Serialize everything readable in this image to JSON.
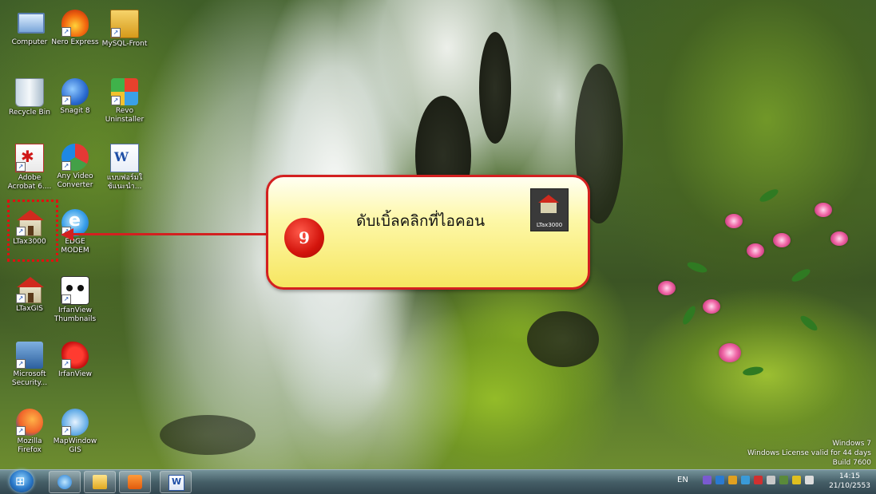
{
  "desktop_icons": [
    {
      "label": "Computer",
      "icon": "computer-icon"
    },
    {
      "label": "Nero Express",
      "icon": "nero-icon"
    },
    {
      "label": "MySQL-Front",
      "icon": "mysql-front-icon"
    },
    {
      "label": "Recycle Bin",
      "icon": "recycle-bin-icon"
    },
    {
      "label": "Snagit 8",
      "icon": "snagit-icon"
    },
    {
      "label": "Revo\nUninstaller",
      "icon": "revo-uninstaller-icon"
    },
    {
      "label": "Adobe\nAcrobat 6....",
      "icon": "acrobat-icon"
    },
    {
      "label": "Any Video\nConverter",
      "icon": "video-converter-icon"
    },
    {
      "label": "แบบฟอร์มใ\nช้แนะนำ...",
      "icon": "word-document-icon"
    },
    {
      "label": "LTax3000",
      "icon": "ltax3000-icon"
    },
    {
      "label": "EDGE\nMODEM",
      "icon": "edge-modem-icon"
    },
    {
      "label": "LTaxGIS",
      "icon": "ltaxgis-icon"
    },
    {
      "label": "IrfanView\nThumbnails",
      "icon": "irfanview-thumbnails-icon"
    },
    {
      "label": "Microsoft\nSecurity...",
      "icon": "microsoft-security-icon"
    },
    {
      "label": "IrfanView",
      "icon": "irfanview-icon"
    },
    {
      "label": "Mozilla\nFirefox",
      "icon": "firefox-icon"
    },
    {
      "label": "MapWindow\nGIS",
      "icon": "mapwindow-icon"
    }
  ],
  "callout": {
    "step_number": "9",
    "instruction": "ดับเบิ้ลคลิกที่ไอคอน",
    "icon_caption": "LTax3000"
  },
  "watermark": {
    "line1": "Windows 7",
    "line2": "Windows License valid for 44 days",
    "line3": "Build 7600"
  },
  "taskbar": {
    "pinned": [
      "internet-explorer-icon",
      "folder-icon",
      "media-player-icon",
      "word-icon"
    ],
    "language": "EN",
    "time": "14:15",
    "date": "21/10/2553"
  }
}
